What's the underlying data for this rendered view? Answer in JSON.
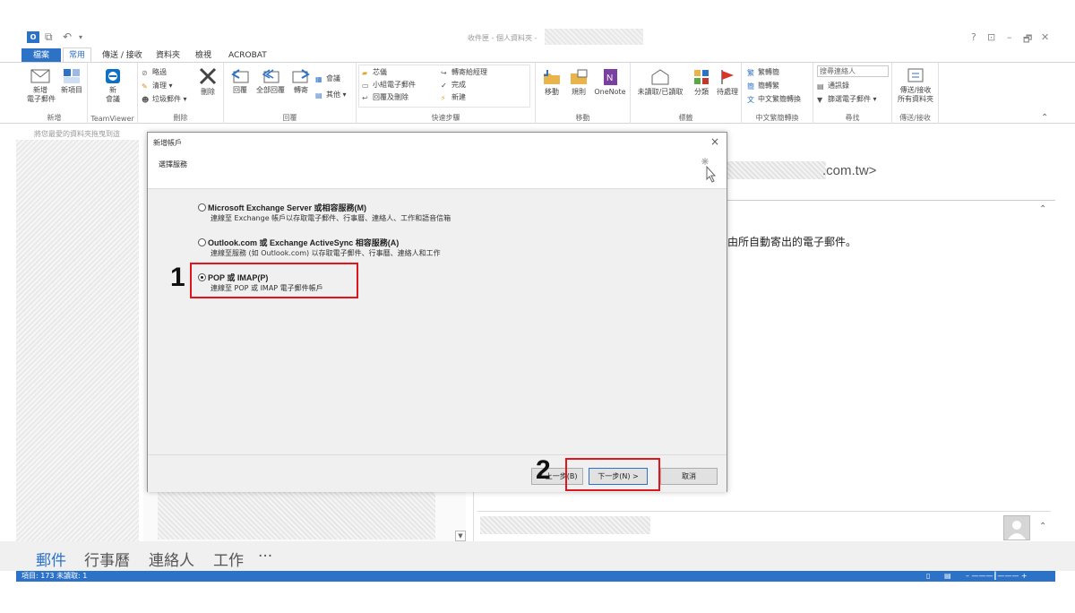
{
  "window": {
    "title": "收件匣 - 個人資料夾 -",
    "controls": [
      "?",
      "⊡",
      "–",
      "🗗",
      "✕"
    ]
  },
  "tabs": [
    "檔案",
    "常用",
    "傳送 / 接收",
    "資料夾",
    "檢視",
    "ACROBAT"
  ],
  "ribbon": {
    "new": {
      "new_email": "新增\n電子郵件",
      "new_items": "新項目",
      "label": "新增"
    },
    "teamviewer": {
      "meeting": "新\n會議",
      "label": "TeamViewer"
    },
    "delete": {
      "ignore": "略過",
      "cleanup": "清理",
      "junk": "垃圾郵件",
      "delete": "刪除",
      "label": "刪除"
    },
    "respond": {
      "reply": "回覆",
      "reply_all": "全部回覆",
      "forward": "轉寄",
      "meeting": "會議",
      "more": "其他",
      "label": "回覆"
    },
    "quicksteps": {
      "items": [
        "芯儀",
        "小組電子郵件",
        "回覆及刪除",
        "轉寄給經理",
        "完成",
        "新建"
      ],
      "label": "快速步驟"
    },
    "move": {
      "move": "移動",
      "rules": "規則",
      "onenote": "OneNote",
      "label": "移動"
    },
    "tags": {
      "unread": "未讀取/已讀取",
      "categorize": "分類",
      "followup": "待處理",
      "label": "標籤"
    },
    "chinese": {
      "to_trad": "繁轉簡",
      "to_simp": "簡轉繁",
      "convert": "中文繁簡轉換",
      "label": "中文繁簡轉換"
    },
    "find": {
      "search_people": "搜尋連絡人",
      "address_book": "通訊錄",
      "filter": "篩選電子郵件",
      "label": "尋找"
    },
    "sendreceive": {
      "button": "傳送/接收\n所有資料夾",
      "label": "傳送/接收"
    }
  },
  "subbar_text": "將您最愛的資料夾拖曳到這",
  "reading": {
    "email_suffix": ".com.tw>",
    "body_text": "由所自動寄出的電子郵件。"
  },
  "nav": [
    "郵件",
    "行事曆",
    "連絡人",
    "工作",
    "···"
  ],
  "status": "項目: 173    未讀取: 1",
  "dialog": {
    "title": "新增帳戶",
    "subtitle": "選擇服務",
    "close": "×",
    "options": [
      {
        "label": "Microsoft Exchange Server 或相容服務(M)",
        "desc": "連線至 Exchange 帳戶以存取電子郵件、行事曆、連絡人、工作和語音信箱",
        "selected": false
      },
      {
        "label": "Outlook.com 或 Exchange ActiveSync 相容服務(A)",
        "desc": "連線至服務 (如 Outlook.com) 以存取電子郵件、行事曆、連絡人和工作",
        "selected": false
      },
      {
        "label": "POP 或 IMAP(P)",
        "desc": "連線至 POP 或 IMAP 電子郵件帳戶",
        "selected": true
      }
    ],
    "back": "< 上一步(B)",
    "next": "下一步(N) >",
    "cancel": "取消"
  },
  "annotations": {
    "step1": "1",
    "step2": "2",
    "color": "#e0161c"
  },
  "colors": {
    "accent": "#2c72c7"
  }
}
